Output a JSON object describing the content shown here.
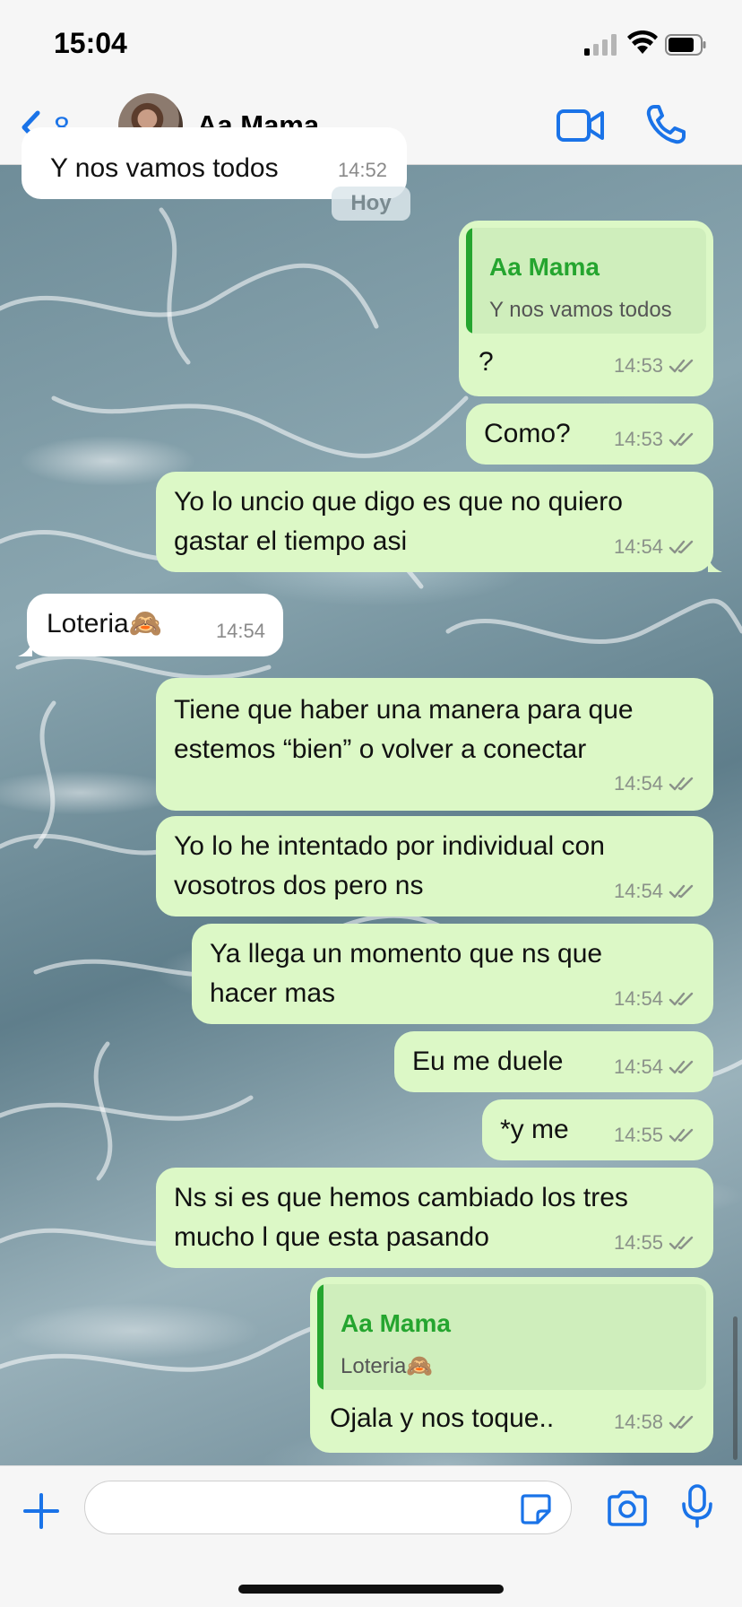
{
  "status_bar": {
    "time": "15:04"
  },
  "header": {
    "back_count": "8",
    "contact_name": "Aa Mama"
  },
  "date_chip": "Hoy",
  "messages": [
    {
      "direction": "in",
      "text": "Y nos vamos todos",
      "time": "14:52"
    },
    {
      "direction": "out",
      "reply_to": {
        "name": "Aa Mama",
        "text": "Y nos vamos todos"
      },
      "text": "?",
      "time": "14:53"
    },
    {
      "direction": "out",
      "text": "Como?",
      "time": "14:53"
    },
    {
      "direction": "out",
      "text": "Yo lo uncio que digo es que no quiero gastar el tiempo asi",
      "time": "14:54"
    },
    {
      "direction": "in",
      "text": "Loteria🙈",
      "time": "14:54"
    },
    {
      "direction": "out",
      "text": "Tiene que haber una manera para que estemos “bien” o volver a conectar",
      "time": "14:54"
    },
    {
      "direction": "out",
      "text": "Yo lo he intentado por individual con vosotros dos pero ns",
      "time": "14:54"
    },
    {
      "direction": "out",
      "text": "Ya llega un momento que ns que hacer mas",
      "time": "14:54"
    },
    {
      "direction": "out",
      "text": "Eu me duele",
      "time": "14:54"
    },
    {
      "direction": "out",
      "text": "*y me",
      "time": "14:55"
    },
    {
      "direction": "out",
      "text": "Ns si es que hemos cambiado los tres mucho l que esta pasando",
      "time": "14:55"
    },
    {
      "direction": "out",
      "reply_to": {
        "name": "Aa Mama",
        "text": "Loteria🙈"
      },
      "text": "Ojala y nos toque..",
      "time": "14:58"
    }
  ],
  "composer": {
    "value": "",
    "placeholder": ""
  },
  "colors": {
    "outgoing_bubble": "#dcf8c6",
    "incoming_bubble": "#ffffff",
    "accent_blue": "#1a73e8",
    "reply_green": "#25a52f"
  },
  "icons": [
    "back-chevron-icon",
    "video-camera-icon",
    "phone-icon",
    "plus-icon",
    "sticker-icon",
    "camera-icon",
    "microphone-icon",
    "signal-icon",
    "wifi-icon",
    "battery-icon",
    "double-check-icon"
  ]
}
